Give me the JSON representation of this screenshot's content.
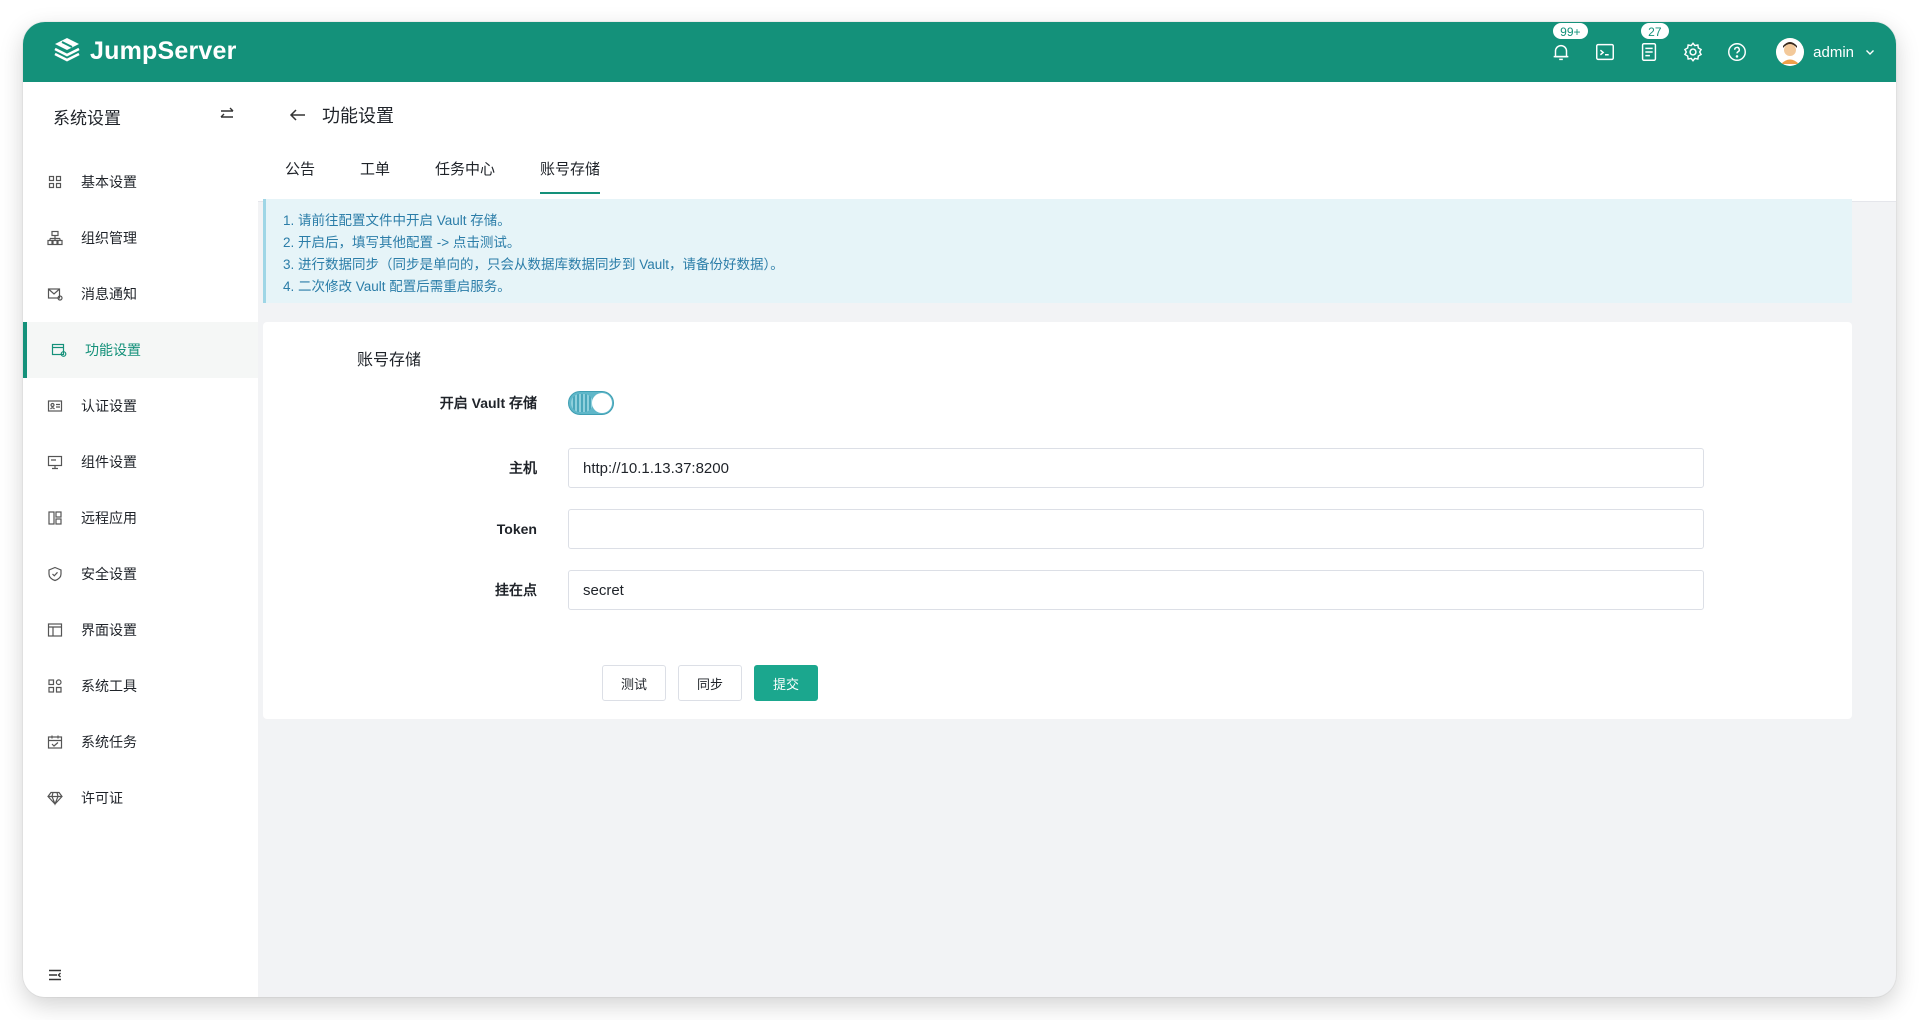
{
  "app": {
    "name": "JumpServer"
  },
  "header": {
    "notifications_badge": "99+",
    "tickets_badge": "27",
    "user_name": "admin"
  },
  "sidebar": {
    "title": "系统设置",
    "items": [
      {
        "label": "基本设置",
        "icon": "grid-icon",
        "active": false
      },
      {
        "label": "组织管理",
        "icon": "org-icon",
        "active": false
      },
      {
        "label": "消息通知",
        "icon": "message-icon",
        "active": false
      },
      {
        "label": "功能设置",
        "icon": "feature-icon",
        "active": true
      },
      {
        "label": "认证设置",
        "icon": "id-card-icon",
        "active": false
      },
      {
        "label": "组件设置",
        "icon": "monitor-icon",
        "active": false
      },
      {
        "label": "远程应用",
        "icon": "apps-icon",
        "active": false
      },
      {
        "label": "安全设置",
        "icon": "shield-icon",
        "active": false
      },
      {
        "label": "界面设置",
        "icon": "window-icon",
        "active": false
      },
      {
        "label": "系统工具",
        "icon": "tools-icon",
        "active": false
      },
      {
        "label": "系统任务",
        "icon": "calendar-icon",
        "active": false
      },
      {
        "label": "许可证",
        "icon": "diamond-icon",
        "active": false
      }
    ]
  },
  "page": {
    "title": "功能设置",
    "tabs": [
      {
        "label": "公告",
        "active": false
      },
      {
        "label": "工单",
        "active": false
      },
      {
        "label": "任务中心",
        "active": false
      },
      {
        "label": "账号存储",
        "active": true
      }
    ]
  },
  "alert": {
    "lines": [
      "1. 请前往配置文件中开启 Vault 存储。",
      "2. 开启后，填写其他配置 -> 点击测试。",
      "3. 进行数据同步（同步是单向的，只会从数据库数据同步到 Vault，请备份好数据）。",
      "4. 二次修改 Vault 配置后需重启服务。"
    ]
  },
  "form": {
    "section_title": "账号存储",
    "vault_label": "开启 Vault 存储",
    "vault_enabled": true,
    "host_label": "主机",
    "host_value": "http://10.1.13.37:8200",
    "token_label": "Token",
    "token_value": "",
    "mount_label": "挂在点",
    "mount_value": "secret",
    "test_label": "测试",
    "sync_label": "同步",
    "submit_label": "提交"
  },
  "colors": {
    "brand": "#14917a",
    "primary_button": "#1ba78e",
    "alert_bg": "#e6f4f8",
    "alert_text": "#2b7da8"
  }
}
